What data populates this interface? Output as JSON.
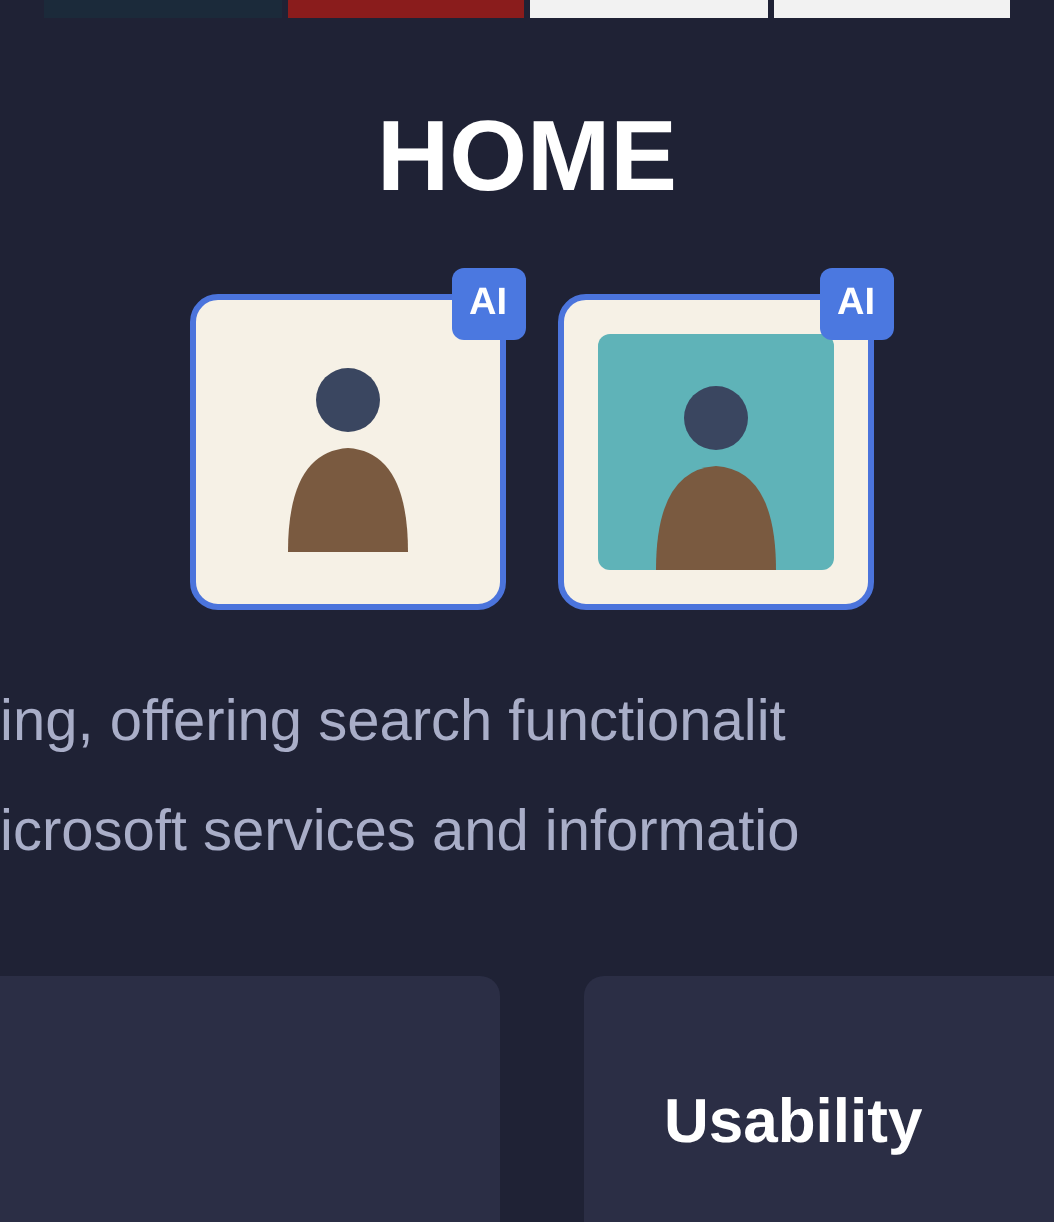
{
  "top_strip": [
    {
      "kind": "dark"
    },
    {
      "kind": "photo"
    },
    {
      "kind": "page"
    },
    {
      "kind": "page"
    }
  ],
  "title": "HOME",
  "avatars": [
    {
      "kind": "plain",
      "badge": "AI"
    },
    {
      "kind": "scene",
      "badge": "AI"
    }
  ],
  "description": [
    "ing, offering search functionalit",
    "icrosoft services and informatio"
  ],
  "cards": [
    {
      "kind": "blank"
    },
    {
      "kind": "titled",
      "title": "Usability"
    }
  ]
}
